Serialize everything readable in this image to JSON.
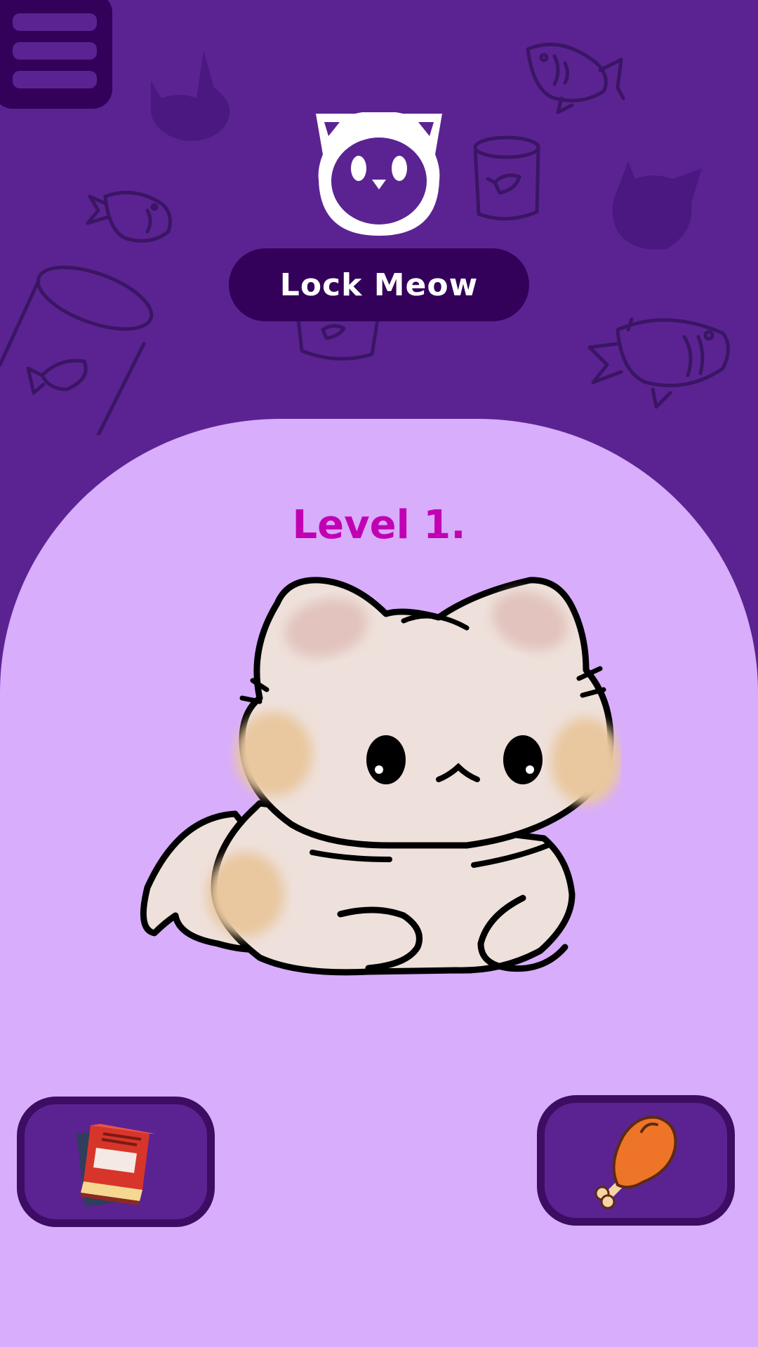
{
  "app": {
    "title": "Lock Meow",
    "level_label": "Level 1."
  },
  "icons": {
    "menu": "hamburger-menu-icon",
    "logo": "cat-head-icon",
    "left_action": "books-icon",
    "right_action": "chicken-drumstick-icon",
    "pet": "kitten-illustration"
  },
  "colors": {
    "background": "#5b2392",
    "panel": "#d8adfb",
    "pill": "#33005a",
    "level_text": "#c100b4",
    "title_text": "#ffffff"
  }
}
